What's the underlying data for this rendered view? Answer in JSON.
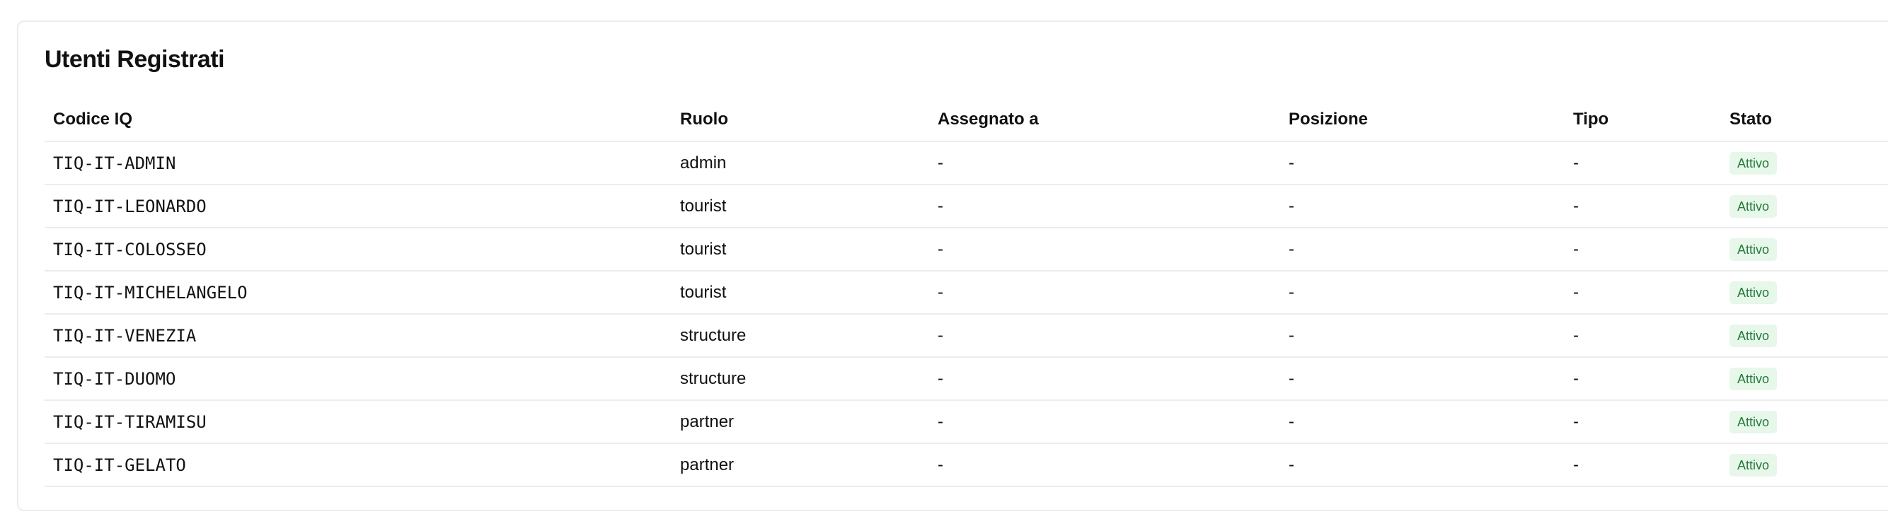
{
  "card": {
    "title": "Utenti Registrati"
  },
  "table": {
    "headers": {
      "code": "Codice IQ",
      "role": "Ruolo",
      "assigned": "Assegnato a",
      "position": "Posizione",
      "type": "Tipo",
      "status": "Stato"
    },
    "rows": [
      {
        "code": "TIQ-IT-ADMIN",
        "role": "admin",
        "assigned": "-",
        "position": "-",
        "type": "-",
        "status": "Attivo"
      },
      {
        "code": "TIQ-IT-LEONARDO",
        "role": "tourist",
        "assigned": "-",
        "position": "-",
        "type": "-",
        "status": "Attivo"
      },
      {
        "code": "TIQ-IT-COLOSSEO",
        "role": "tourist",
        "assigned": "-",
        "position": "-",
        "type": "-",
        "status": "Attivo"
      },
      {
        "code": "TIQ-IT-MICHELANGELO",
        "role": "tourist",
        "assigned": "-",
        "position": "-",
        "type": "-",
        "status": "Attivo"
      },
      {
        "code": "TIQ-IT-VENEZIA",
        "role": "structure",
        "assigned": "-",
        "position": "-",
        "type": "-",
        "status": "Attivo"
      },
      {
        "code": "TIQ-IT-DUOMO",
        "role": "structure",
        "assigned": "-",
        "position": "-",
        "type": "-",
        "status": "Attivo"
      },
      {
        "code": "TIQ-IT-TIRAMISU",
        "role": "partner",
        "assigned": "-",
        "position": "-",
        "type": "-",
        "status": "Attivo"
      },
      {
        "code": "TIQ-IT-GELATO",
        "role": "partner",
        "assigned": "-",
        "position": "-",
        "type": "-",
        "status": "Attivo"
      }
    ]
  },
  "colors": {
    "badge_bg": "#e7f7ea",
    "badge_text": "#237a3b",
    "border": "#ececec"
  }
}
